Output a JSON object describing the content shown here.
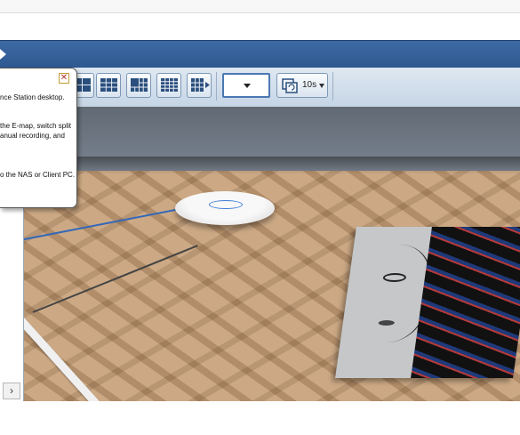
{
  "toolbar": {
    "layout_buttons": [
      "split-2x2",
      "split-3x3",
      "split-4x4",
      "split-1-plus-5",
      "split-5x5",
      "split-more"
    ],
    "stream_dropdown": {
      "value": ""
    },
    "sequence": {
      "interval": "10s"
    }
  },
  "tooltip": {
    "line1": "nce Station desktop.",
    "line2": "the E-map, switch split",
    "line3": "anual recording, and",
    "line4": "o the NAS or Client PC."
  },
  "sidebar": {
    "scroll_right": "›"
  },
  "colors": {
    "title_bar": "#2d578f",
    "toolbar": "#d3dfec",
    "accent_border": "#4a78b3"
  }
}
